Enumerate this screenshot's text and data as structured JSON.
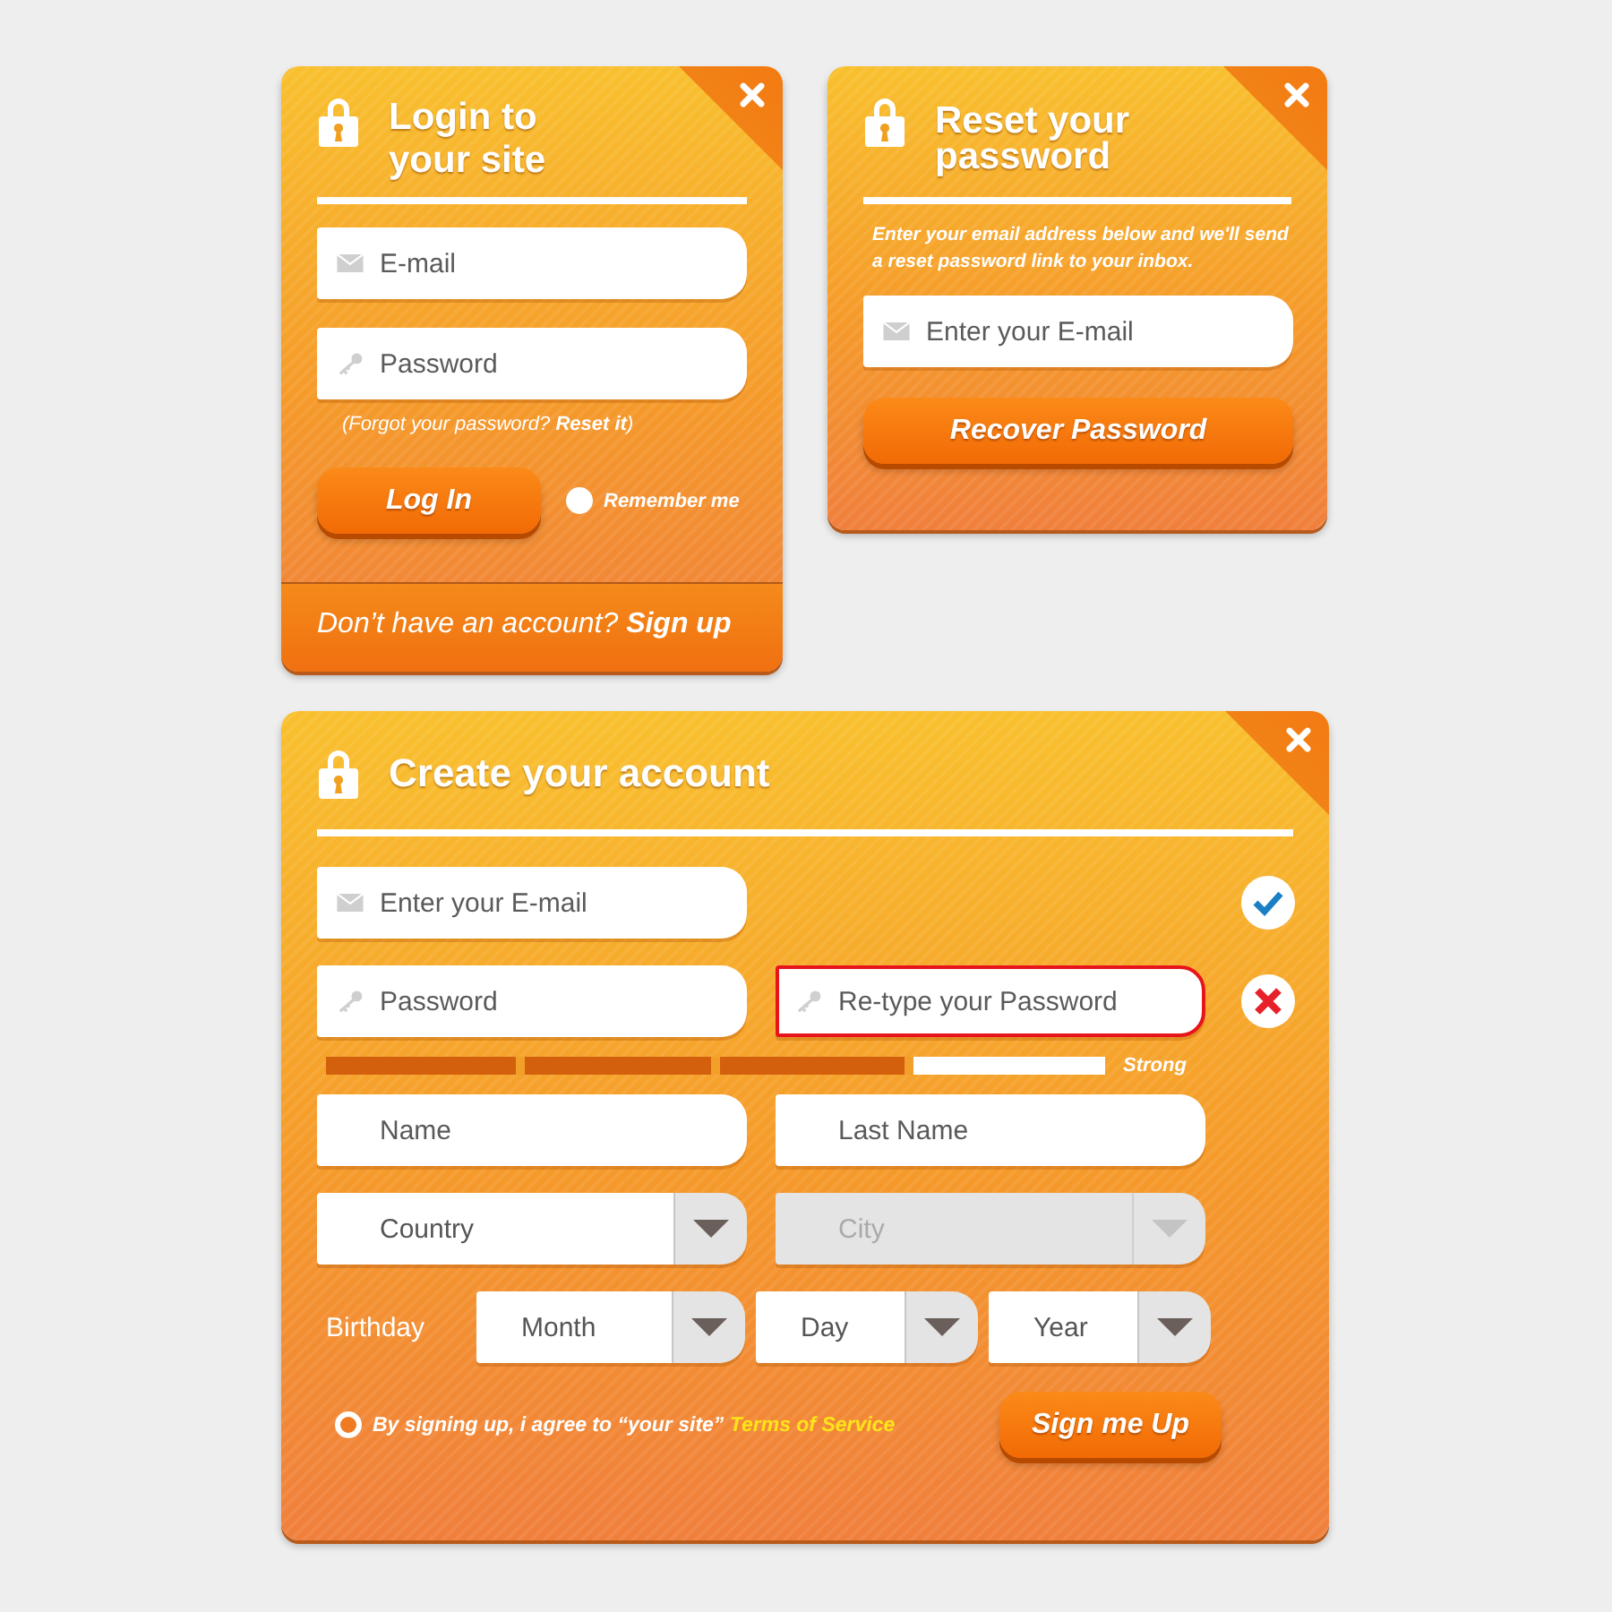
{
  "login": {
    "title": "Login to your site",
    "fields": [
      {
        "kind": "email",
        "placeholder": "E-mail"
      },
      {
        "kind": "password",
        "placeholder": "Password"
      }
    ],
    "forgot": {
      "text": "(Forgot your password?",
      "link": "Reset it",
      "end": ")"
    },
    "button": "Log In",
    "remember": {
      "label": "Remember me",
      "checked": false
    },
    "footer": {
      "text": "Don’t have an account?",
      "link": "Sign up"
    }
  },
  "reset": {
    "title": "Reset your password",
    "description": "Enter your email address below and we'll send a reset password link to your inbox.",
    "field": {
      "kind": "email",
      "placeholder": "Enter your E-mail"
    },
    "button": "Recover Password"
  },
  "signup": {
    "title": "Create your account",
    "email": {
      "kind": "email",
      "placeholder": "Enter your E-mail",
      "valid": true
    },
    "password": {
      "kind": "password",
      "placeholder": "Password"
    },
    "retype": {
      "kind": "password",
      "placeholder": "Re-type your Password",
      "valid": false
    },
    "strength": {
      "level": 0.75,
      "label": "Strong"
    },
    "name": {
      "placeholder": "Name"
    },
    "last_name": {
      "placeholder": "Last Name"
    },
    "country": {
      "label": "Country",
      "disabled": false
    },
    "city": {
      "label": "City",
      "disabled": true
    },
    "birthday": {
      "label": "Birthday",
      "selects": [
        {
          "label": "Month"
        },
        {
          "label": "Day"
        },
        {
          "label": "Year"
        }
      ]
    },
    "terms": {
      "text": "By signing up, i agree to “your site”",
      "link": "Terms of Service",
      "checked": true
    },
    "button": "Sign me Up"
  }
}
